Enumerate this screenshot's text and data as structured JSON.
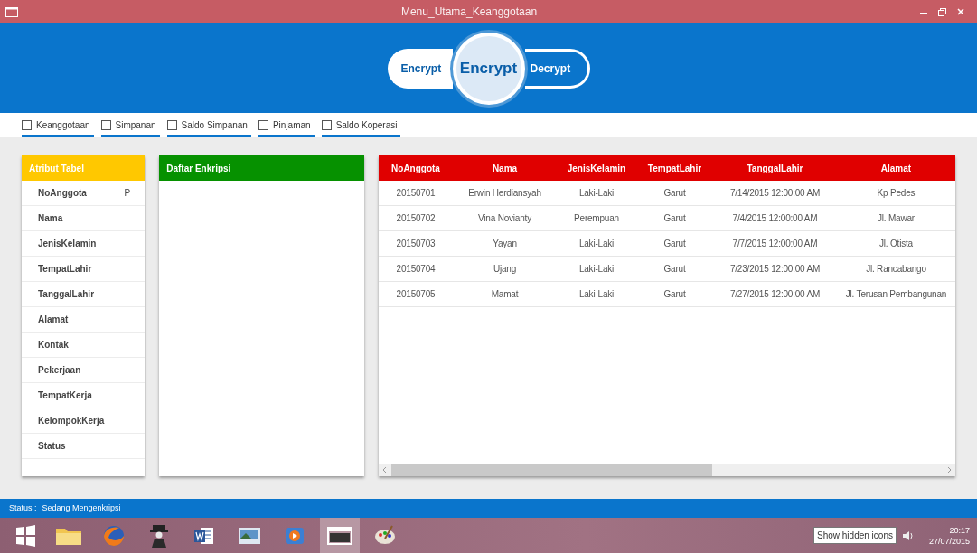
{
  "window": {
    "title": "Menu_Utama_Keanggotaan"
  },
  "switch": {
    "options": [
      {
        "label": "Encrypt",
        "selected": true
      },
      {
        "label": "Decrypt",
        "selected": false
      }
    ],
    "knob": "Encrypt"
  },
  "menu_checkboxes": [
    {
      "label": "Keanggotaan",
      "checked": false
    },
    {
      "label": "Simpanan",
      "checked": false
    },
    {
      "label": "Saldo Simpanan",
      "checked": false
    },
    {
      "label": "Pinjaman",
      "checked": false
    },
    {
      "label": "Saldo Koperasi",
      "checked": false
    }
  ],
  "attributes_panel": {
    "title": "Atribut Tabel",
    "items": [
      {
        "name": "NoAnggota",
        "key": "P"
      },
      {
        "name": "Nama"
      },
      {
        "name": "JenisKelamin"
      },
      {
        "name": "TempatLahir"
      },
      {
        "name": "TanggalLahir"
      },
      {
        "name": "Alamat"
      },
      {
        "name": "Kontak"
      },
      {
        "name": "Pekerjaan"
      },
      {
        "name": "TempatKerja"
      },
      {
        "name": "KelompokKerja"
      },
      {
        "name": "Status"
      }
    ]
  },
  "encryption_panel": {
    "title": "Daftar Enkripsi"
  },
  "table": {
    "columns": [
      "NoAnggota",
      "Nama",
      "JenisKelamin",
      "TempatLahir",
      "TanggalLahir",
      "Alamat"
    ],
    "rows": [
      [
        "20150701",
        "Erwin Herdiansyah",
        "Laki-Laki",
        "Garut",
        "7/14/2015 12:00:00 AM",
        "Kp Pedes"
      ],
      [
        "20150702",
        "Vina Novianty",
        "Perempuan",
        "Garut",
        "7/4/2015 12:00:00 AM",
        "Jl. Mawar"
      ],
      [
        "20150703",
        "Yayan",
        "Laki-Laki",
        "Garut",
        "7/7/2015 12:00:00 AM",
        "Jl. Otista"
      ],
      [
        "20150704",
        "Ujang",
        "Laki-Laki",
        "Garut",
        "7/23/2015 12:00:00 AM",
        "Jl. Rancabango"
      ],
      [
        "20150705",
        "Mamat",
        "Laki-Laki",
        "Garut",
        "7/27/2015 12:00:00 AM",
        "Jl. Terusan Pembangunan"
      ]
    ]
  },
  "status_bar": {
    "label": "Status :",
    "value": "Sedang Mengenkripsi"
  },
  "taskbar": {
    "tooltip": "Show hidden icons",
    "time": "20:17",
    "date": "27/07/2015"
  }
}
